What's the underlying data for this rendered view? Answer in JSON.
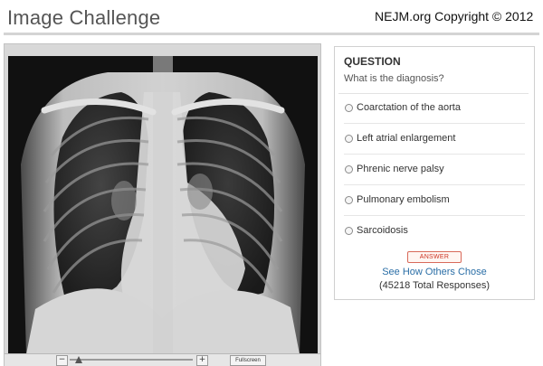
{
  "header": {
    "title": "Image Challenge",
    "copyright": "NEJM.org Copyright © 2012"
  },
  "viewer": {
    "image": "chest-xray",
    "toolbar": {
      "zoom_out": "−",
      "zoom_in": "+",
      "fullscreen": "Fullscreen"
    }
  },
  "question": {
    "heading": "QUESTION",
    "text": "What is the diagnosis?",
    "options": [
      "Coarctation of the aorta",
      "Left atrial enlargement",
      "Phrenic nerve palsy",
      "Pulmonary embolism",
      "Sarcoidosis"
    ],
    "answer_label": "ANSWER",
    "others_link": "See How Others Chose",
    "responses": "(45218 Total Responses)"
  },
  "colors": {
    "title": "#555555",
    "link": "#2a6ea6",
    "answer": "#cc3322"
  }
}
